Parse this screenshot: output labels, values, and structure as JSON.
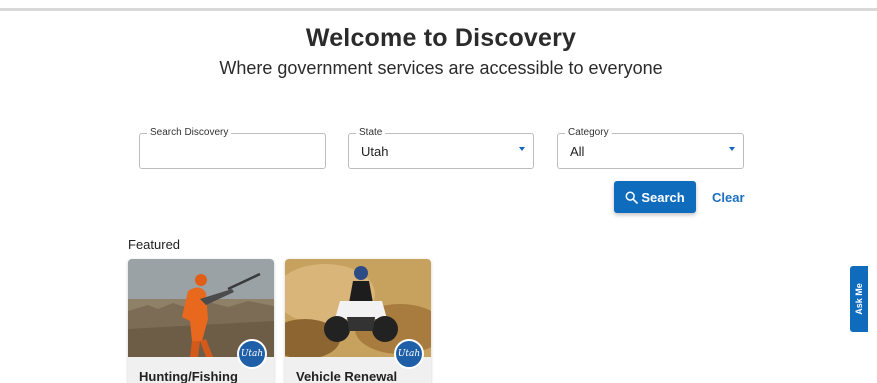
{
  "hero": {
    "title": "Welcome to Discovery",
    "subtitle": "Where government services are accessible to everyone"
  },
  "filters": {
    "search": {
      "label": "Search Discovery",
      "value": ""
    },
    "state": {
      "label": "State",
      "value": "Utah"
    },
    "category": {
      "label": "Category",
      "value": "All"
    }
  },
  "actions": {
    "search_label": "Search",
    "clear_label": "Clear"
  },
  "featured": {
    "heading": "Featured",
    "cards": [
      {
        "title": "Hunting/Fishing",
        "badge": "Utah"
      },
      {
        "title": "Vehicle Renewal",
        "badge": "Utah"
      }
    ]
  },
  "ask_me": {
    "label": "Ask Me"
  },
  "colors": {
    "accent": "#0f6cbd",
    "link": "#1a6fc0",
    "badge": "#1f5fa8"
  }
}
